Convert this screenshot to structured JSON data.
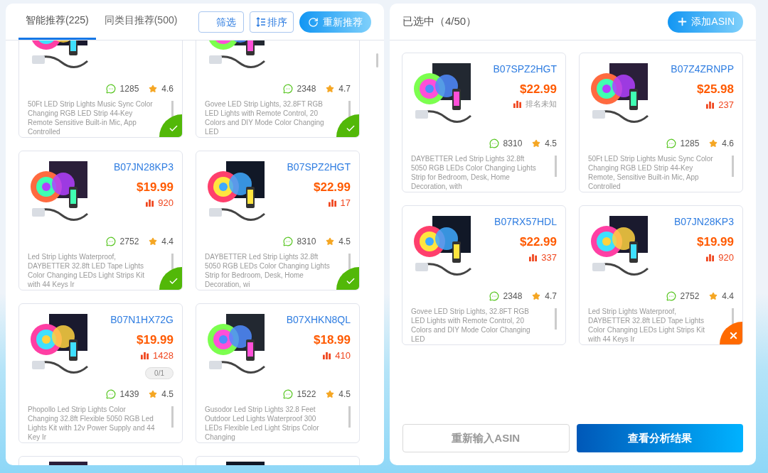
{
  "left_panel": {
    "tabs": [
      {
        "label": "智能推荐(225)",
        "selected": true
      },
      {
        "label": "同类目推荐(500)",
        "selected": false
      }
    ],
    "filter_button": "筛选",
    "sort_button": "排序",
    "refresh_button": "重新推荐",
    "products": [
      {
        "kind": "product",
        "reviews": "1285",
        "rating": "4.6",
        "description": "50Ft LED Strip Lights Music Sync Color Changing RGB LED Strip 44-Key Remote Sensitive Built-in Mic, App Controlled",
        "selected": true
      },
      {
        "kind": "product",
        "reviews": "2348",
        "rating": "4.7",
        "description": "Govee LED Strip Lights, 32.8FT RGB LED Lights with Remote Control, 20 Colors and DIY Mode Color Changing LED",
        "selected": true
      },
      {
        "kind": "product",
        "asin": "B07JN28KP3",
        "price": "$19.99",
        "rank": "920",
        "rank_known": true,
        "reviews": "2752",
        "rating": "4.4",
        "description": "Led Strip Lights Waterproof, DAYBETTER 32.8ft LED Tape Lights Color Changing LEDs Light Strips Kit with 44 Keys Ir",
        "selected": true
      },
      {
        "kind": "product",
        "asin": "B07SPZ2HGT",
        "price": "$22.99",
        "rank": "17",
        "rank_known": true,
        "reviews": "8310",
        "rating": "4.5",
        "description": "DAYBETTER Led Strip Lights 32.8ft 5050 RGB LEDs Color Changing Lights Strip for Bedroom, Desk, Home Decoration, wi",
        "selected": true
      },
      {
        "kind": "product",
        "asin": "B07N1HX72G",
        "price": "$19.99",
        "rank": "1428",
        "rank_known": true,
        "badge": "0/1",
        "reviews": "1439",
        "rating": "4.5",
        "description": "Phopollo Led Strip Lights Color Changing 32.8ft Flexible 5050 RGB Led Lights Kit with 12v Power Supply and 44 Key Ir",
        "selected": false
      },
      {
        "kind": "product",
        "asin": "B07XHKN8QL",
        "price": "$18.99",
        "rank": "410",
        "rank_known": true,
        "reviews": "1522",
        "rating": "4.5",
        "description": "Gusodor Led Strip Lights 32.8 Feet Outdoor Led Lights Waterproof 300 LEDs Flexible Led Light Strips Color Changing",
        "selected": false
      },
      {
        "kind": "peek"
      },
      {
        "kind": "peek"
      }
    ]
  },
  "right_panel": {
    "title": "已选中（4/50）",
    "add_button": "添加ASIN",
    "products": [
      {
        "asin": "B07SPZ2HGT",
        "price": "$22.99",
        "rank": "排名未知",
        "rank_known": false,
        "reviews": "8310",
        "rating": "4.5",
        "description": "DAYBETTER Led Strip Lights 32.8ft 5050 RGB LEDs Color Changing Lights Strip for Bedroom, Desk, Home Decoration, with",
        "hovered": false
      },
      {
        "asin": "B07Z4ZRNPP",
        "price": "$25.98",
        "rank": "237",
        "rank_known": true,
        "reviews": "1285",
        "rating": "4.6",
        "description": "50Ft LED Strip Lights Music Sync Color Changing RGB LED Strip 44-Key Remote, Sensitive Built-in Mic, App Controlled",
        "hovered": false
      },
      {
        "asin": "B07RX57HDL",
        "price": "$22.99",
        "rank": "337",
        "rank_known": true,
        "reviews": "2348",
        "rating": "4.7",
        "description": "Govee LED Strip Lights, 32.8FT RGB LED Lights with Remote Control, 20 Colors and DIY Mode Color Changing LED",
        "hovered": false
      },
      {
        "asin": "B07JN28KP3",
        "price": "$19.99",
        "rank": "920",
        "rank_known": true,
        "reviews": "2752",
        "rating": "4.4",
        "description": "Led Strip Lights Waterproof, DAYBETTER 32.8ft LED Tape Lights Color Changing LEDs Light Strips Kit with 44 Keys Ir",
        "hovered": true
      }
    ],
    "reenter_button": "重新输入ASIN",
    "view_button": "查看分析结果"
  }
}
